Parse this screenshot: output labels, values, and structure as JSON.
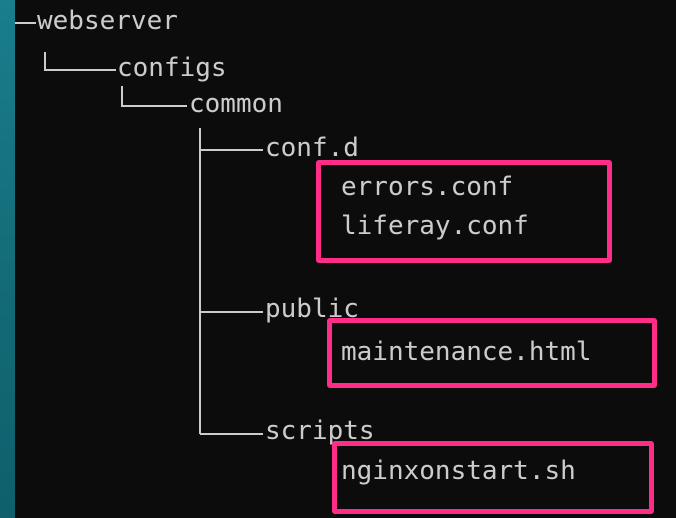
{
  "terminal": {
    "background": "#0c0c0c",
    "text_color": "#cccccc",
    "highlight_color": "#ff2d87",
    "tree": {
      "root": "webserver",
      "configs": "configs",
      "common": "common",
      "confd": "conf.d",
      "errors": "errors.conf",
      "liferay": "liferay.conf",
      "public": "public",
      "maintenance": "maintenance.html",
      "scripts": "scripts",
      "nginxonstart": "nginxonstart.sh"
    }
  }
}
